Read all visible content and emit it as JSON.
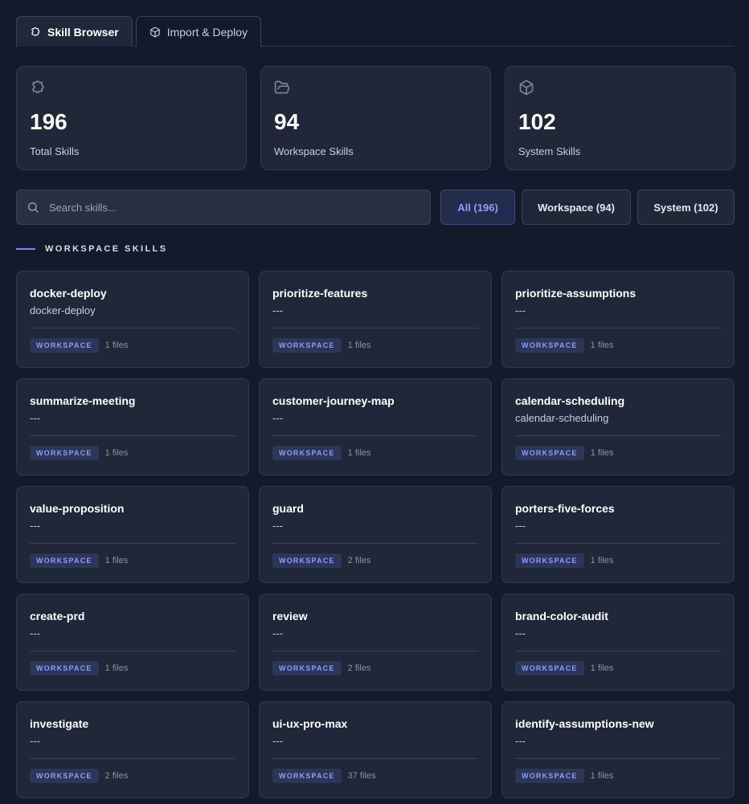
{
  "tabs": [
    {
      "label": "Skill Browser",
      "icon": "puzzle-icon",
      "active": true
    },
    {
      "label": "Import & Deploy",
      "icon": "package-icon",
      "active": false
    }
  ],
  "stats": [
    {
      "value": "196",
      "label": "Total Skills",
      "icon": "puzzle-icon"
    },
    {
      "value": "94",
      "label": "Workspace Skills",
      "icon": "folder-open-icon"
    },
    {
      "value": "102",
      "label": "System Skills",
      "icon": "package-icon"
    }
  ],
  "search": {
    "placeholder": "Search skills..."
  },
  "filters": [
    {
      "label": "All (196)",
      "active": true
    },
    {
      "label": "Workspace (94)",
      "active": false
    },
    {
      "label": "System (102)",
      "active": false
    }
  ],
  "section_title": "WORKSPACE SKILLS",
  "skills": [
    {
      "name": "docker-deploy",
      "desc": "docker-deploy",
      "badge": "WORKSPACE",
      "files": "1 files"
    },
    {
      "name": "prioritize-features",
      "desc": "---",
      "badge": "WORKSPACE",
      "files": "1 files"
    },
    {
      "name": "prioritize-assumptions",
      "desc": "---",
      "badge": "WORKSPACE",
      "files": "1 files"
    },
    {
      "name": "summarize-meeting",
      "desc": "---",
      "badge": "WORKSPACE",
      "files": "1 files"
    },
    {
      "name": "customer-journey-map",
      "desc": "---",
      "badge": "WORKSPACE",
      "files": "1 files"
    },
    {
      "name": "calendar-scheduling",
      "desc": "calendar-scheduling",
      "badge": "WORKSPACE",
      "files": "1 files"
    },
    {
      "name": "value-proposition",
      "desc": "---",
      "badge": "WORKSPACE",
      "files": "1 files"
    },
    {
      "name": "guard",
      "desc": "---",
      "badge": "WORKSPACE",
      "files": "2 files"
    },
    {
      "name": "porters-five-forces",
      "desc": "---",
      "badge": "WORKSPACE",
      "files": "1 files"
    },
    {
      "name": "create-prd",
      "desc": "---",
      "badge": "WORKSPACE",
      "files": "1 files"
    },
    {
      "name": "review",
      "desc": "---",
      "badge": "WORKSPACE",
      "files": "2 files"
    },
    {
      "name": "brand-color-audit",
      "desc": "---",
      "badge": "WORKSPACE",
      "files": "1 files"
    },
    {
      "name": "investigate",
      "desc": "---",
      "badge": "WORKSPACE",
      "files": "2 files"
    },
    {
      "name": "ui-ux-pro-max",
      "desc": "---",
      "badge": "WORKSPACE",
      "files": "37 files"
    },
    {
      "name": "identify-assumptions-new",
      "desc": "---",
      "badge": "WORKSPACE",
      "files": "1 files"
    }
  ],
  "colors": {
    "background": "#121a2b",
    "card": "#1f2738",
    "accent": "#8f9cff",
    "border": "#323b4d"
  }
}
